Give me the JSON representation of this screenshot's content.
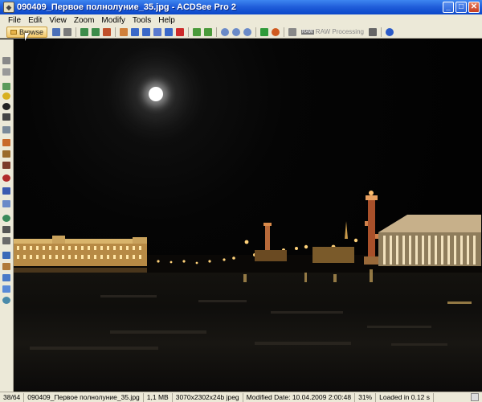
{
  "window": {
    "title": "090409_Первое полнолуние_35.jpg - ACDSee Pro 2",
    "minimize_glyph": "_",
    "maximize_glyph": "□",
    "close_glyph": "✕"
  },
  "menu": [
    "File",
    "Edit",
    "View",
    "Zoom",
    "Modify",
    "Tools",
    "Help"
  ],
  "toolbar": {
    "browse_label": "Browse",
    "raw_badge": "RAW",
    "raw_label": "RAW Processing",
    "icons": [
      "save-icon",
      "print-icon",
      "prev-image-icon",
      "next-image-icon",
      "rotate-icon",
      "open-icon",
      "copy-icon",
      "email-icon",
      "edit-icon",
      "delete-icon",
      "back-icon",
      "forward-icon",
      "zoom-in-icon",
      "zoom-out-icon",
      "zoom-fit-icon",
      "slideshow-icon",
      "color-icon",
      "properties-icon",
      "help-icon"
    ]
  },
  "image": {
    "description_colors": {
      "moon": "#ffffff",
      "lights": "#ffd27a",
      "buildings_lit": "#e9c98b"
    }
  },
  "status": {
    "position": "38/64",
    "filename": "090409_Первое полнолуние_35.jpg",
    "filesize": "1,1 MB",
    "dimensions": "3070x2302x24b jpeg",
    "modified": "Modified Date: 10.04.2009 2:00:48",
    "zoom": "31%",
    "loaded": "Loaded in 0.12 s"
  }
}
